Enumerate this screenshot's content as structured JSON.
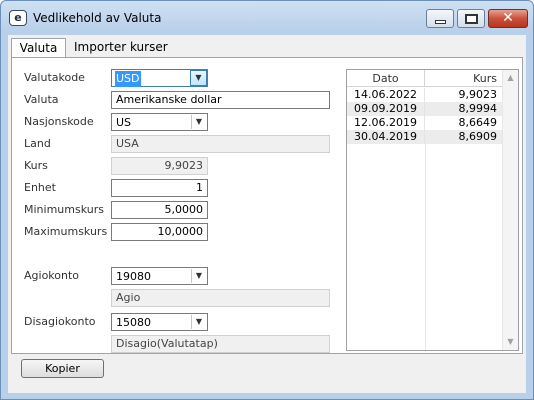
{
  "window": {
    "title": "Vedlikehold av Valuta",
    "app_icon_glyph": "e",
    "close_glyph": "✕"
  },
  "tabs": [
    {
      "label": "Valuta",
      "active": true
    },
    {
      "label": "Importer kurser",
      "active": false
    }
  ],
  "form": {
    "valutakode": {
      "label": "Valutakode",
      "value": "USD"
    },
    "valuta": {
      "label": "Valuta",
      "value": "Amerikanske dollar"
    },
    "nasjonskode": {
      "label": "Nasjonskode",
      "value": "US"
    },
    "land": {
      "label": "Land",
      "value": "USA"
    },
    "kurs": {
      "label": "Kurs",
      "value": "9,9023"
    },
    "enhet": {
      "label": "Enhet",
      "value": "1"
    },
    "minimumskurs": {
      "label": "Minimumskurs",
      "value": "5,0000"
    },
    "maximumskurs": {
      "label": "Maximumskurs",
      "value": "10,0000"
    },
    "agiokonto": {
      "label": "Agiokonto",
      "value": "19080",
      "description": "Agio"
    },
    "disagiokonto": {
      "label": "Disagiokonto",
      "value": "15080",
      "description": "Disagio(Valutatap)"
    }
  },
  "rate_grid": {
    "columns": [
      "Dato",
      "Kurs"
    ],
    "rows": [
      {
        "dato": "14.06.2022",
        "kurs": "9,9023"
      },
      {
        "dato": "09.09.2019",
        "kurs": "8,9994"
      },
      {
        "dato": "12.06.2019",
        "kurs": "8,6649"
      },
      {
        "dato": "30.04.2019",
        "kurs": "8,6909"
      }
    ]
  },
  "buttons": {
    "kopier": "Kopier"
  },
  "icons": {
    "dropdown": "▼",
    "scroll_up": "▲",
    "scroll_down": "▼"
  },
  "colors": {
    "selection": "#3399ff",
    "close_button": "#c8523c"
  }
}
